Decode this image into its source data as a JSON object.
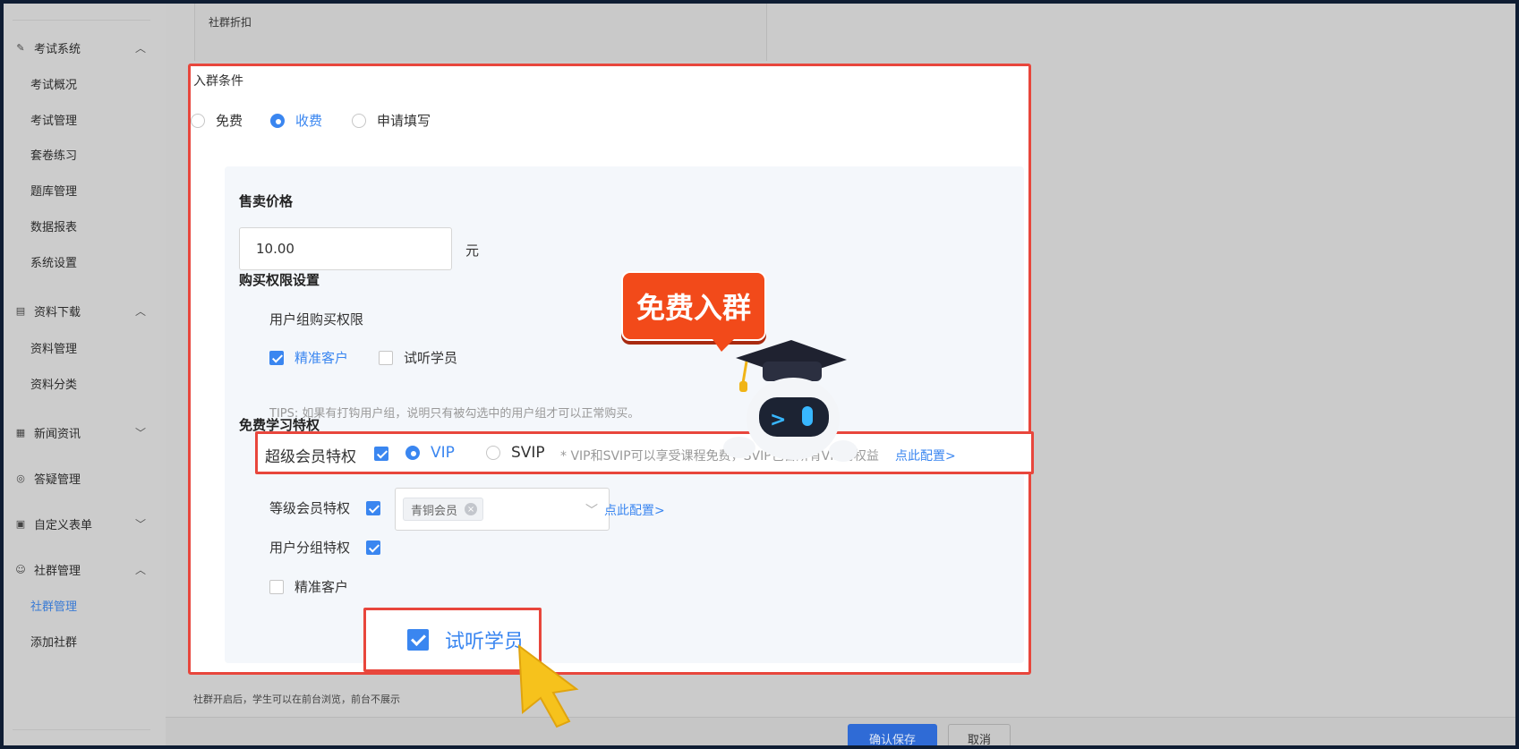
{
  "sidebar": {
    "groups": [
      {
        "label": "考试系统",
        "chev": "⌃",
        "icon": "edit-icon"
      },
      {
        "label": "资料下载",
        "chev": "⌃",
        "icon": "file-icon"
      },
      {
        "label": "新闻资讯",
        "chev": "⌄",
        "icon": "news-icon"
      },
      {
        "label": "答疑管理",
        "chev": "",
        "icon": "qa-icon"
      },
      {
        "label": "自定义表单",
        "chev": "⌄",
        "icon": "form-icon"
      },
      {
        "label": "社群管理",
        "chev": "⌃",
        "icon": "group-icon"
      }
    ],
    "items": [
      "考试概况",
      "考试管理",
      "套卷练习",
      "题库管理",
      "数据报表",
      "系统设置",
      "资料管理",
      "资料分类",
      "社群管理",
      "添加社群"
    ]
  },
  "background": {
    "card_title": "社群折扣",
    "note": "社群开启后，学生可以在前台浏览，前台不展示",
    "save_label": "确认保存",
    "cancel_label": "取消"
  },
  "panel": {
    "title": "入群条件",
    "radios": [
      {
        "label": "免费",
        "checked": false
      },
      {
        "label": "收费",
        "checked": true
      },
      {
        "label": "申请填写",
        "checked": false
      }
    ],
    "price_label": "售卖价格",
    "price_value": "10.00",
    "price_unit": "元",
    "purchase_title": "购买权限设置",
    "user_group_label": "用户组购买权限",
    "group_options": [
      {
        "label": "精准客户",
        "checked": true
      },
      {
        "label": "试听学员",
        "checked": false
      }
    ],
    "tips": "TIPS: 如果有打钩用户组，说明只有被勾选中的用户组才可以正常购买。",
    "free_title": "免费学习特权",
    "super_member_label": "超级会员特权",
    "vip_label": "VIP",
    "svip_label": "SVIP",
    "vip_note": "* VIP和SVIP可以享受课程免费，SVIP包含所有VIP的权益",
    "config_link": "点此配置>",
    "level_member_label": "等级会员特权",
    "level_tag": "青铜会员",
    "level_config_link": "点此配置>",
    "user_group_priv_label": "用户分组特权",
    "group_priv_option": "精准客户",
    "trial_label": "试听学员"
  },
  "overlay": {
    "badge_text": "免费入群"
  },
  "colors": {
    "accent": "#3a86f0",
    "highlight_border": "#e8463c",
    "badge": "#f24a1a"
  }
}
